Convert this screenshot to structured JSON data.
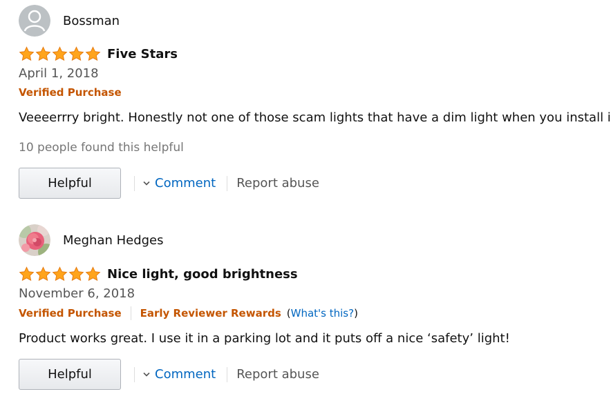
{
  "reviews": [
    {
      "profile_name": "Bossman",
      "avatar": "default-avatar",
      "rating": 5,
      "title": "Five Stars",
      "date": "April 1, 2018",
      "verified": "Verified Purchase",
      "body": "Veeeerrry bright. Honestly not one of those scam lights that have a dim light when you install it",
      "helpful_count": "10 people found this helpful",
      "helpful_button": "Helpful",
      "comment_label": "Comment",
      "report_label": "Report abuse"
    },
    {
      "profile_name": "Meghan Hedges",
      "avatar": "flower-photo-avatar",
      "rating": 5,
      "title": "Nice light, good brightness",
      "date": "November 6, 2018",
      "verified": "Verified Purchase",
      "early_reviewer": "Early Reviewer Rewards",
      "whats_this_open": "(",
      "whats_this": "What's this?",
      "whats_this_close": ")",
      "body": "Product works great. I use it in a parking lot and it puts off a nice ‘safety’ light!",
      "helpful_button": "Helpful",
      "comment_label": "Comment",
      "report_label": "Report abuse"
    }
  ],
  "colors": {
    "star": "#ffa41c",
    "badge": "#c45500",
    "link": "#0066c0"
  }
}
